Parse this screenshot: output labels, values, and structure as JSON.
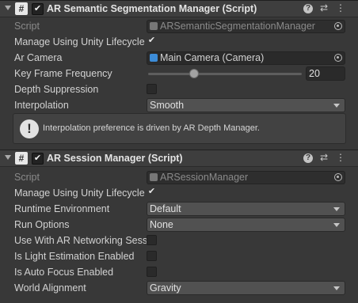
{
  "components": [
    {
      "title": "AR Semantic Segmentation Manager (Script)",
      "enabled": "✔",
      "icon": "#",
      "script": {
        "label": "Script",
        "value": "ARSemanticSegmentationManager"
      },
      "manage_lifecycle": {
        "label": "Manage Using Unity Lifecycle",
        "check": "✔"
      },
      "ar_camera": {
        "label": "Ar Camera",
        "value": "Main Camera (Camera)"
      },
      "key_frame": {
        "label": "Key Frame Frequency",
        "value": "20",
        "slider_fraction": 0.3
      },
      "depth_suppression": {
        "label": "Depth Suppression"
      },
      "interpolation": {
        "label": "Interpolation",
        "value": "Smooth"
      },
      "help": {
        "icon": "!",
        "text": "Interpolation preference is driven by AR Depth Manager."
      }
    },
    {
      "title": "AR Session Manager (Script)",
      "enabled": "✔",
      "icon": "#",
      "script": {
        "label": "Script",
        "value": "ARSessionManager"
      },
      "manage_lifecycle": {
        "label": "Manage Using Unity Lifecycle",
        "check": "✔"
      },
      "runtime_env": {
        "label": "Runtime Environment",
        "value": "Default"
      },
      "run_options": {
        "label": "Run Options",
        "value": "None"
      },
      "networking": {
        "label": "Use With AR Networking Session"
      },
      "light_estimation": {
        "label": "Is Light Estimation Enabled"
      },
      "auto_focus": {
        "label": "Is Auto Focus Enabled"
      },
      "world_alignment": {
        "label": "World Alignment",
        "value": "Gravity"
      }
    }
  ],
  "header_icons": [
    "help-icon",
    "presets-icon",
    "more-icon"
  ],
  "colors": {
    "background": "#383838",
    "field": "#2a2a2a",
    "dropdown": "#515151",
    "camera_icon": "#3c8cd8"
  }
}
